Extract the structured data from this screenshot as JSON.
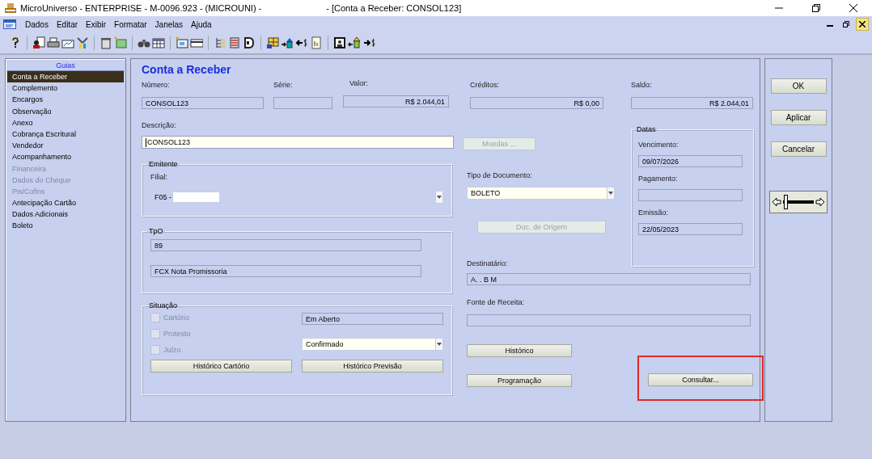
{
  "window": {
    "title_left": "MicroUniverso - ENTERPRISE - M-0096.923 - (MICROUNI) -",
    "title_right": "- [Conta a Receber: CONSOL123]"
  },
  "menu": [
    "Dados",
    "Editar",
    "Exibir",
    "Formatar",
    "Janelas",
    "Ajuda"
  ],
  "guides": {
    "title": "Guias",
    "items": [
      {
        "label": "Conta a Receber",
        "selected": true,
        "disabled": false
      },
      {
        "label": "Complemento",
        "selected": false,
        "disabled": false
      },
      {
        "label": "Encargos",
        "selected": false,
        "disabled": false
      },
      {
        "label": "Observação",
        "selected": false,
        "disabled": false
      },
      {
        "label": "Anexo",
        "selected": false,
        "disabled": false
      },
      {
        "label": "Cobrança Escritural",
        "selected": false,
        "disabled": false
      },
      {
        "label": "Vendedor",
        "selected": false,
        "disabled": false
      },
      {
        "label": "Acompanhamento",
        "selected": false,
        "disabled": false
      },
      {
        "label": "Financeira",
        "selected": false,
        "disabled": true
      },
      {
        "label": "Dados do Cheque",
        "selected": false,
        "disabled": true
      },
      {
        "label": "Pis/Cofins",
        "selected": false,
        "disabled": true
      },
      {
        "label": "Antecipação Cartão",
        "selected": false,
        "disabled": false
      },
      {
        "label": "Dados Adicionais",
        "selected": false,
        "disabled": false
      },
      {
        "label": "Boleto",
        "selected": false,
        "disabled": false
      }
    ]
  },
  "form": {
    "title": "Conta a Receber",
    "summary": [
      {
        "label": "Número:",
        "value": "CONSOL123",
        "kind": "text"
      },
      {
        "label": "Série:",
        "kind": "text"
      },
      {
        "label": "Valor:",
        "value": "R$ 2.044,01",
        "kind": "money"
      },
      {
        "label": "Créditos:",
        "value": "R$ 0,00",
        "kind": "money"
      },
      {
        "label": "Saldo:",
        "value": "R$ 2.044,01",
        "kind": "money"
      }
    ],
    "descricao": {
      "label": "Descrição:",
      "value": "CONSOL123"
    },
    "moedas_button": {
      "label": "Moedas ...",
      "disabled": true
    },
    "emitente": {
      "title": "Emitente",
      "label": "Filial:",
      "value": "F05 -"
    },
    "tpo": {
      "title": "TpO",
      "code": "89",
      "name": "FCX Nota Promissoria"
    },
    "situacao": {
      "title": "Situação",
      "checks": [
        {
          "label": "Cartório",
          "checked": false,
          "disabled": true
        },
        {
          "label": "Protesto",
          "checked": false,
          "disabled": true
        },
        {
          "label": "Juízo",
          "checked": false,
          "disabled": true
        }
      ],
      "status": "Em Aberto",
      "confirm": "Confirmado",
      "buttons": [
        "Histórico Cartório",
        "Histórico Previsão"
      ]
    },
    "tipo_documento": {
      "label": "Tipo de Documento:",
      "value": "BOLETO"
    },
    "doc_origem_button": {
      "label": "Doc. de Origem",
      "disabled": true
    },
    "datas": {
      "title": "Datas",
      "fields": [
        {
          "label": "Vencimento:",
          "value": "09/07/2026"
        },
        {
          "label": "Pagamento:"
        },
        {
          "label": "Emissão:",
          "value": "22/05/2023"
        }
      ]
    },
    "destinatario": {
      "label": "Destinatário:",
      "value": "A.  . B M"
    },
    "fonte_receita": {
      "label": "Fonte de Receita:"
    },
    "historico_button": "Histórico",
    "programacao_button": "Programação",
    "consultar_button": {
      "label": "Consultar...",
      "highlighted": true
    }
  },
  "actions": [
    "OK",
    "Aplicar",
    "Cancelar"
  ],
  "slider": {
    "level": 0.08
  }
}
